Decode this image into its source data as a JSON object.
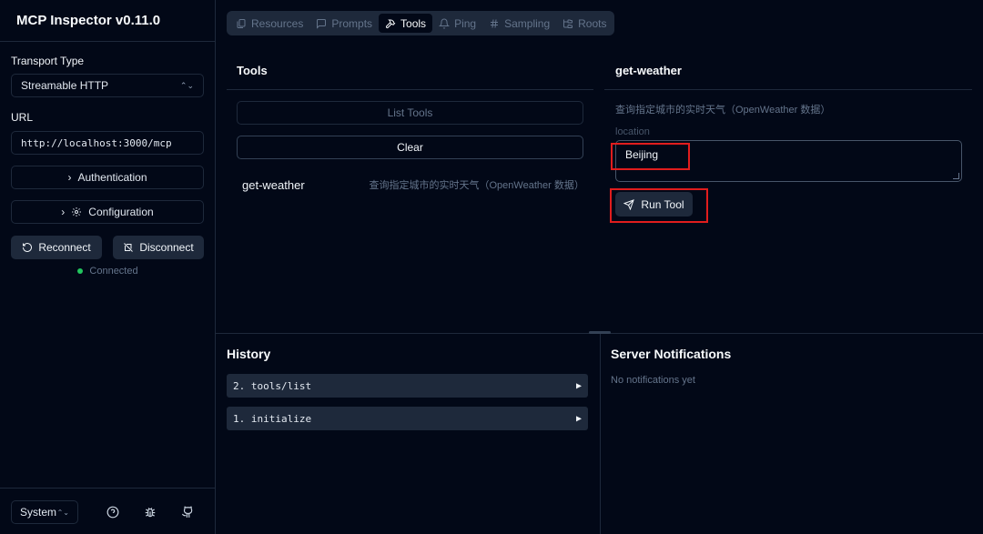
{
  "app": {
    "title": "MCP Inspector v0.11.0"
  },
  "sidebar": {
    "transport_label": "Transport Type",
    "transport_value": "Streamable HTTP",
    "url_label": "URL",
    "url_value": "http://localhost:3000/mcp",
    "authentication_label": "Authentication",
    "configuration_label": "Configuration",
    "reconnect_label": "Reconnect",
    "disconnect_label": "Disconnect",
    "status_text": "Connected",
    "status_color": "#22c55e",
    "theme_value": "System"
  },
  "tabs": [
    {
      "label": "Resources",
      "icon": "files-icon",
      "active": false
    },
    {
      "label": "Prompts",
      "icon": "message-square-icon",
      "active": false
    },
    {
      "label": "Tools",
      "icon": "hammer-icon",
      "active": true
    },
    {
      "label": "Ping",
      "icon": "bell-icon",
      "active": false
    },
    {
      "label": "Sampling",
      "icon": "hash-icon",
      "active": false
    },
    {
      "label": "Roots",
      "icon": "folder-tree-icon",
      "active": false
    }
  ],
  "tools_panel": {
    "title": "Tools",
    "list_button": "List Tools",
    "clear_button": "Clear",
    "items": [
      {
        "name": "get-weather",
        "description": "查询指定城市的实时天气（OpenWeather 数据）"
      }
    ]
  },
  "tool_detail": {
    "title": "get-weather",
    "description": "查询指定城市的实时天气（OpenWeather 数据）",
    "param_label": "location",
    "param_value": "Beijing",
    "run_button": "Run Tool",
    "highlight_color": "#e11d1d"
  },
  "history": {
    "title": "History",
    "items": [
      "2. tools/list",
      "1. initialize"
    ]
  },
  "notifications": {
    "title": "Server Notifications",
    "empty_text": "No notifications yet"
  }
}
